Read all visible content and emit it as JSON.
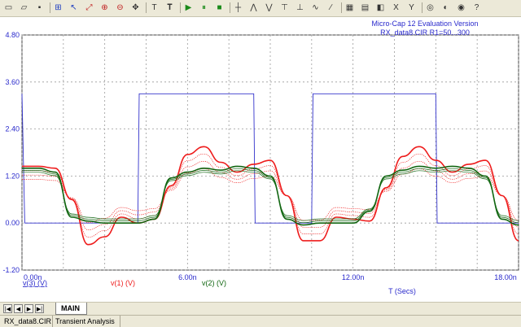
{
  "toolbar": {
    "buttons": [
      "file-icon",
      "open-folder-icon",
      "save-icon",
      "stepping-icon",
      "select-icon",
      "scale-icon",
      "zoom-icon",
      "zoom-out-icon",
      "panning-icon",
      "text-icon",
      "bold-text-icon",
      "run-icon",
      "pause-icon",
      "stop-icon",
      "cursor-mode-icon",
      "peak-icon",
      "valley-icon",
      "high-icon",
      "low-icon",
      "inflection-icon",
      "slope-icon",
      "graph-layout-icon",
      "table-icon",
      "tokens-icon",
      "go-to-x-icon",
      "go-to-y-icon",
      "performance-icon",
      "animate-icon",
      "properties-icon",
      "help-icon"
    ]
  },
  "plot": {
    "title_line1": "Micro-Cap 12 Evaluation Version",
    "title_line2": "RX_data8.CIR R1=50...300",
    "x_axis_label": "T (Secs)",
    "y_ticks": [
      "4.80",
      "3.60",
      "2.40",
      "1.20",
      "0.00",
      "-1.20"
    ],
    "x_ticks": [
      "0.00n",
      "6.00n",
      "12.00n",
      "18.00n"
    ],
    "legend": {
      "v3": "v(3) (V)",
      "v1": "v(1) (V)",
      "v2": "v(2) (V)"
    }
  },
  "chart_data": {
    "type": "line",
    "title": "RX_data8.CIR R1=50...300",
    "xlabel": "T (Secs)",
    "ylabel": "",
    "xlim": [
      0,
      18
    ],
    "x_unit": "ns",
    "ylim": [
      -1.2,
      4.8
    ],
    "grid": true,
    "series": [
      {
        "name": "v(3) (V)",
        "color": "#3333cc",
        "x": [
          0,
          0.1,
          4.2,
          4.25,
          8.4,
          8.45,
          10.5,
          10.55,
          15.0,
          15.05,
          18.0
        ],
        "values": [
          3.3,
          0.0,
          0.0,
          3.3,
          3.3,
          0.0,
          0.0,
          3.3,
          3.3,
          0.0,
          0.0
        ]
      },
      {
        "name": "v(1) (V)",
        "color": "#ee1c1c",
        "x": [
          0,
          0.6,
          1.2,
          1.8,
          2.4,
          3.0,
          3.6,
          4.2,
          4.8,
          5.4,
          6.0,
          6.6,
          7.2,
          7.8,
          8.4,
          9.0,
          9.6,
          10.2,
          10.8,
          11.4,
          12.0,
          12.6,
          13.2,
          13.8,
          14.4,
          15.0,
          15.6,
          16.2,
          16.8,
          17.4,
          18.0
        ],
        "values": [
          1.45,
          1.45,
          1.4,
          0.6,
          -0.55,
          -0.35,
          0.15,
          0.0,
          0.1,
          0.95,
          1.75,
          1.95,
          1.55,
          1.3,
          1.5,
          1.6,
          0.7,
          -0.45,
          -0.45,
          0.15,
          0.1,
          0.05,
          0.9,
          1.7,
          1.95,
          1.6,
          1.3,
          1.5,
          1.6,
          0.7,
          -0.45
        ]
      },
      {
        "name": "v(2) (V)",
        "color": "#116611",
        "x": [
          0,
          0.6,
          1.2,
          1.8,
          2.4,
          3.0,
          3.6,
          4.2,
          4.8,
          5.4,
          6.0,
          6.6,
          7.2,
          7.8,
          8.4,
          9.0,
          9.6,
          10.2,
          10.8,
          11.4,
          12.0,
          12.6,
          13.2,
          13.8,
          14.4,
          15.0,
          15.6,
          16.2,
          16.8,
          17.4,
          18.0
        ],
        "values": [
          1.4,
          1.4,
          1.3,
          0.15,
          0.05,
          0.0,
          0.0,
          0.0,
          0.1,
          1.15,
          1.3,
          1.4,
          1.35,
          1.45,
          1.4,
          1.2,
          0.1,
          -0.05,
          0.0,
          0.0,
          0.0,
          0.3,
          1.2,
          1.35,
          1.45,
          1.4,
          1.45,
          1.4,
          1.2,
          0.1,
          -0.05
        ]
      }
    ]
  },
  "tabs": {
    "nav": [
      "|◀",
      "◀",
      "▶",
      "▶|"
    ],
    "main": "MAIN"
  },
  "status": {
    "file": "RX_data8.CIR",
    "mode": "Transient Analysis"
  }
}
